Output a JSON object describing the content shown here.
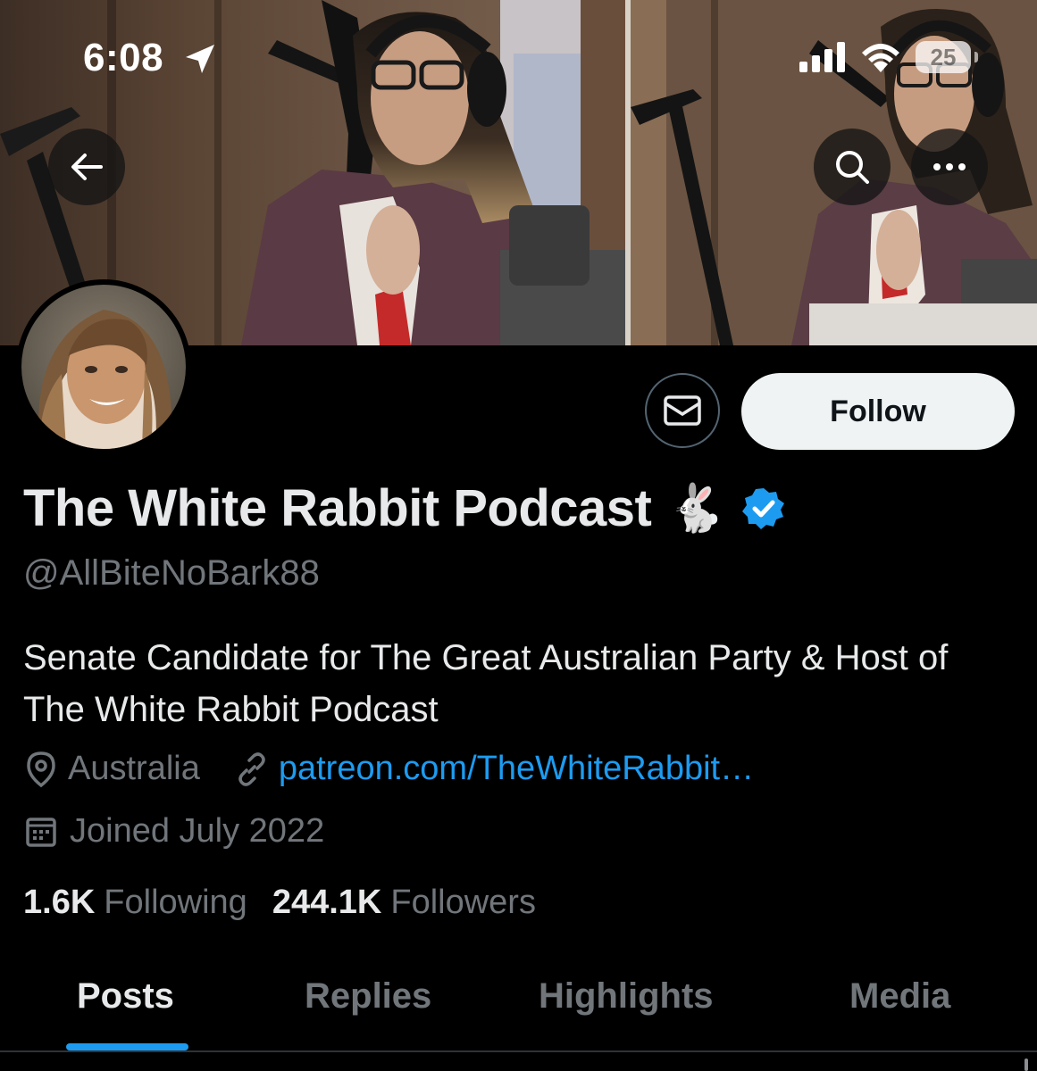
{
  "status_bar": {
    "time": "6:08",
    "battery_level": "25"
  },
  "icons": {
    "location": "location-arrow-icon",
    "signal": "cellular-signal-icon",
    "wifi": "wifi-icon",
    "battery": "battery-icon",
    "back": "back-arrow-icon",
    "search": "search-icon",
    "more": "more-icon",
    "message": "envelope-icon",
    "verified": "verified-badge-icon",
    "location_pin": "location-pin-icon",
    "link": "link-icon",
    "calendar": "calendar-icon"
  },
  "profile": {
    "display_name": "The White Rabbit Podcast",
    "name_emoji": "🐇",
    "handle": "@AllBiteNoBark88",
    "bio": "Senate Candidate for The Great Australian Party & Host of The White Rabbit Podcast",
    "location": "Australia",
    "website": "patreon.com/TheWhiteRabbit…",
    "joined": "Joined July 2022",
    "following_count": "1.6K",
    "following_label": "Following",
    "followers_count": "244.1K",
    "followers_label": "Followers"
  },
  "actions": {
    "follow_label": "Follow"
  },
  "tabs": [
    {
      "label": "Posts",
      "active": true
    },
    {
      "label": "Replies",
      "active": false
    },
    {
      "label": "Highlights",
      "active": false
    },
    {
      "label": "Media",
      "active": false
    }
  ],
  "colors": {
    "background": "#000000",
    "accent": "#1d9bf0",
    "secondary_text": "#71767b",
    "primary_text": "#e7e9ea",
    "follow_button": "#eff3f4"
  }
}
